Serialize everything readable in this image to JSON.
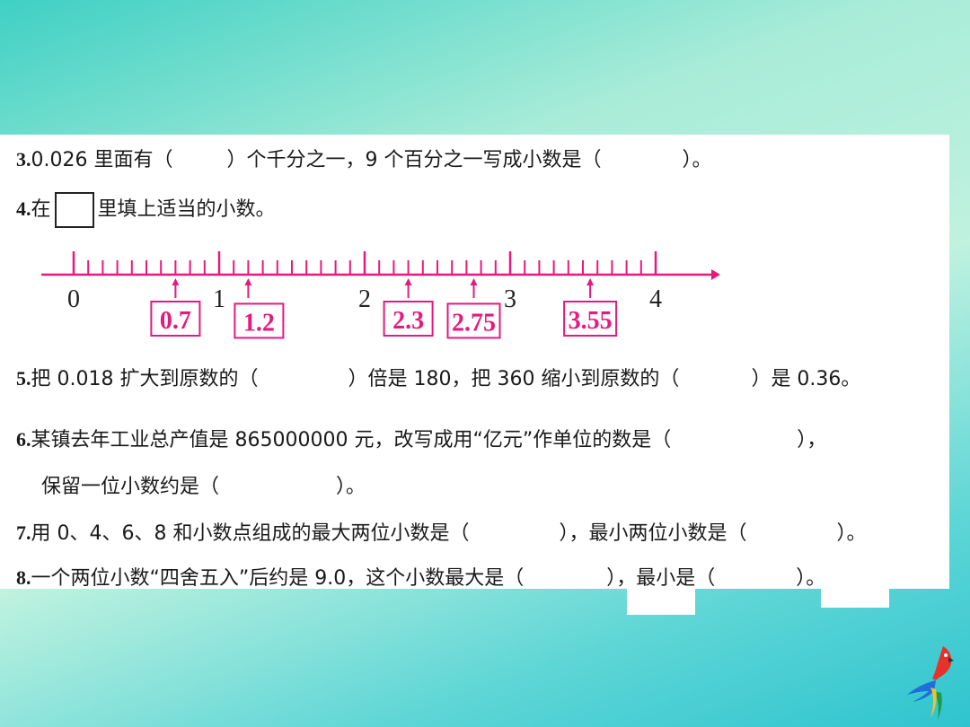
{
  "q3": {
    "num": "3.",
    "a": "0.026 里面有（",
    "b": "）个千分之一，9 个百分之一写成小数是（",
    "c": "）。"
  },
  "q4": {
    "num": "4.",
    "a": "在",
    "b": "里填上适当的小数。"
  },
  "number_line": {
    "labels": [
      "0",
      "1",
      "2",
      "3",
      "4"
    ],
    "answers": [
      {
        "value": 0.7,
        "text": "0.7"
      },
      {
        "value": 1.2,
        "text": "1.2"
      },
      {
        "value": 2.3,
        "text": "2.3"
      },
      {
        "value": 2.75,
        "text": "2.75"
      },
      {
        "value": 3.55,
        "text": "3.55"
      }
    ],
    "color": "#e6197e"
  },
  "q5": {
    "num": "5.",
    "a": "把 0.018 扩大到原数的（",
    "b": "）倍是 180，把 360 缩小到原数的（",
    "c": "）是 0.36。"
  },
  "q6": {
    "num": "6.",
    "a": "某镇去年工业总产值是 865000000 元，改写成用“亿元”作单位的数是（",
    "b": "），",
    "c": "保留一位小数约是（",
    "d": "）。"
  },
  "q7": {
    "num": "7.",
    "a": "用 0、4、6、8 和小数点组成的最大两位小数是（",
    "b": "），最小两位小数是（",
    "c": "）。"
  },
  "q8": {
    "num": "8.",
    "a": "一个两位小数“四舍五入”后约是 9.0，这个小数最大是（",
    "b": "），最小是（",
    "c": "）。"
  }
}
